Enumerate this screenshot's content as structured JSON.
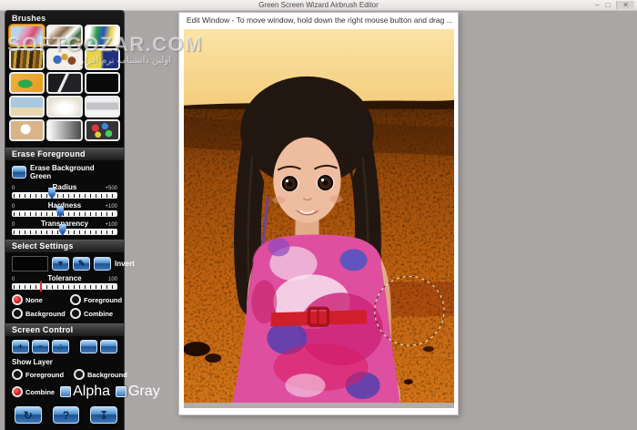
{
  "app": {
    "title": "Green Screen Wizard Airbrush Editor",
    "minimize": "–",
    "maximize": "□",
    "close": "✕"
  },
  "watermark": {
    "line1": "SOFTGOZAR.COM",
    "line2": "اولین دانشنامه نرم افزار"
  },
  "sidebar": {
    "brushes": {
      "title": "Brushes",
      "items": [
        {
          "name": "pink-swirl",
          "selected": true,
          "bg": "linear-gradient(120deg,#b9d4ea 25%,#e890b8 45%,#d4506e 62%,#b9d4ea 82%)"
        },
        {
          "name": "dog-collage",
          "selected": false,
          "bg": "linear-gradient(135deg,#f5f0e8 15%,#8a6a4a 40%,#ffffff 58%,#3a6a3a 75%,#c89a6a 95%)"
        },
        {
          "name": "paint-streak",
          "selected": false,
          "bg": "linear-gradient(100deg,#ffffff 12%,#2e9e4f 32%,#2255c0 52%,#e8d24a 72%,#ffffff 90%)"
        },
        {
          "name": "gold-abstract",
          "selected": false,
          "bg": "repeating-linear-gradient(95deg,#6a4a18 0 4px,#c8a23a 4px 7px,#3a2a0c 7px 11px,#a87828 11px 14px)"
        },
        {
          "name": "color-circles",
          "selected": false,
          "bg": "radial-gradient(circle at 28% 52%,#3a6ac0 0 16%,rgba(0,0,0,0) 17%),radial-gradient(circle at 50% 38%,#d4a23a 0 16%,rgba(0,0,0,0) 17%),radial-gradient(circle at 72% 58%,#8a4a2a 0 15%,rgba(0,0,0,0) 16%),#f2efe8"
        },
        {
          "name": "yellow-blue-paint",
          "selected": false,
          "bg": "linear-gradient(90deg,#e8d44a 0 44%,#20307e 54% 100%)"
        },
        {
          "name": "green-splash",
          "selected": false,
          "bg": "radial-gradient(ellipse at 45% 55%,#2ea84a 0 28%,rgba(0,0,0,0) 30%),linear-gradient(135deg,#f0b23a,#e89a20)"
        },
        {
          "name": "black-suit",
          "selected": false,
          "bg": "linear-gradient(115deg,#1c1c1e 42%,#e8e8ea 43% 50%,#222226 51%)"
        },
        {
          "name": "wedding-dress",
          "selected": false,
          "bg": "linear-gradient(120deg,#2a3a2a 28%,#ececе4 48%,#f4f4ec 58%,#4a5a4a 78%)"
        },
        {
          "name": "beach-palm",
          "selected": false,
          "bg": "linear-gradient(180deg,#a8c8e0 0 55%,#e8d8b0 55% 100%)"
        },
        {
          "name": "white-silk",
          "selected": false,
          "bg": "radial-gradient(ellipse at 50% 60%,#ffffff 28%,#e6e0d2 75%)"
        },
        {
          "name": "printer",
          "selected": false,
          "bg": "linear-gradient(180deg,#eeeef0 0 28%,#c4c4c8 28% 68%,#f4f4f6 68%)"
        },
        {
          "name": "light-bulb",
          "selected": false,
          "bg": "radial-gradient(circle at 46% 44%,#ffffff 0 24%,#d8b488 26%)"
        },
        {
          "name": "gray-gradient",
          "selected": false,
          "bg": "linear-gradient(90deg,#fcfcfc,#4a4a4a)"
        },
        {
          "name": "paint-cans",
          "selected": false,
          "bg": "radial-gradient(circle at 28% 38%,#d43a3a 0 14%,rgba(0,0,0,0) 15%),radial-gradient(circle at 58% 28%,#3a8ad4 0 14%,rgba(0,0,0,0) 15%),radial-gradient(circle at 70% 68%,#3ad45a 0 13%,rgba(0,0,0,0) 14%),radial-gradient(circle at 36% 74%,#d4d43a 0 12%,rgba(0,0,0,0) 13%),#383236"
        }
      ]
    },
    "erase": {
      "title": "Erase Foreground",
      "toggle_label": "Erase Background Green",
      "sliders": [
        {
          "name": "radius",
          "label": "Radius",
          "min": "0",
          "max": "+500",
          "pos": 38
        },
        {
          "name": "hardness",
          "label": "Hardness",
          "min": "0",
          "max": "+100",
          "pos": 46
        },
        {
          "name": "transparency",
          "label": "Transparency",
          "min": "0",
          "max": "+100",
          "pos": 48
        }
      ]
    },
    "select": {
      "title": "Select Settings",
      "invert_label": "Invert",
      "dropdown_glyph": "▼",
      "pencil_glyph": "✎",
      "tolerance": {
        "label": "Tolerance",
        "min": "0",
        "max": "100",
        "pos": 28
      },
      "radios": [
        {
          "name": "none",
          "label": "None",
          "selected": true
        },
        {
          "name": "foreground",
          "label": "Foreground",
          "selected": false
        },
        {
          "name": "background",
          "label": "Background",
          "selected": false
        },
        {
          "name": "combine",
          "label": "Combine",
          "selected": false
        }
      ]
    },
    "screen": {
      "title": "Screen Control",
      "zoom_in_glyph": "+",
      "zoom_out_glyph": "−",
      "home_glyph": "⌂",
      "show_layer_label": "Show Layer",
      "radios": [
        {
          "name": "foreground",
          "label": "Foreground",
          "selected": false
        },
        {
          "name": "background",
          "label": "Background",
          "selected": false
        },
        {
          "name": "combine",
          "label": "Combine",
          "selected": true
        }
      ],
      "checkboxes": [
        {
          "name": "alpha",
          "label": "Alpha",
          "checked": false
        },
        {
          "name": "gray",
          "label": "Gray",
          "checked": false
        }
      ],
      "refresh_glyph": "↻",
      "help_label": "?",
      "download_glyph": "↧"
    }
  },
  "edit_window": {
    "title": "Edit Window - To move window, hold down the right mouse button and drag ..."
  },
  "colors": {
    "accent_blue": "#3f77b8",
    "selected_red": "#c40a0a",
    "brush_selected_border": "#f2b23c",
    "sky": "#f6d58d",
    "terrain": "#b85c10",
    "belt_red": "#cf1f2a"
  }
}
